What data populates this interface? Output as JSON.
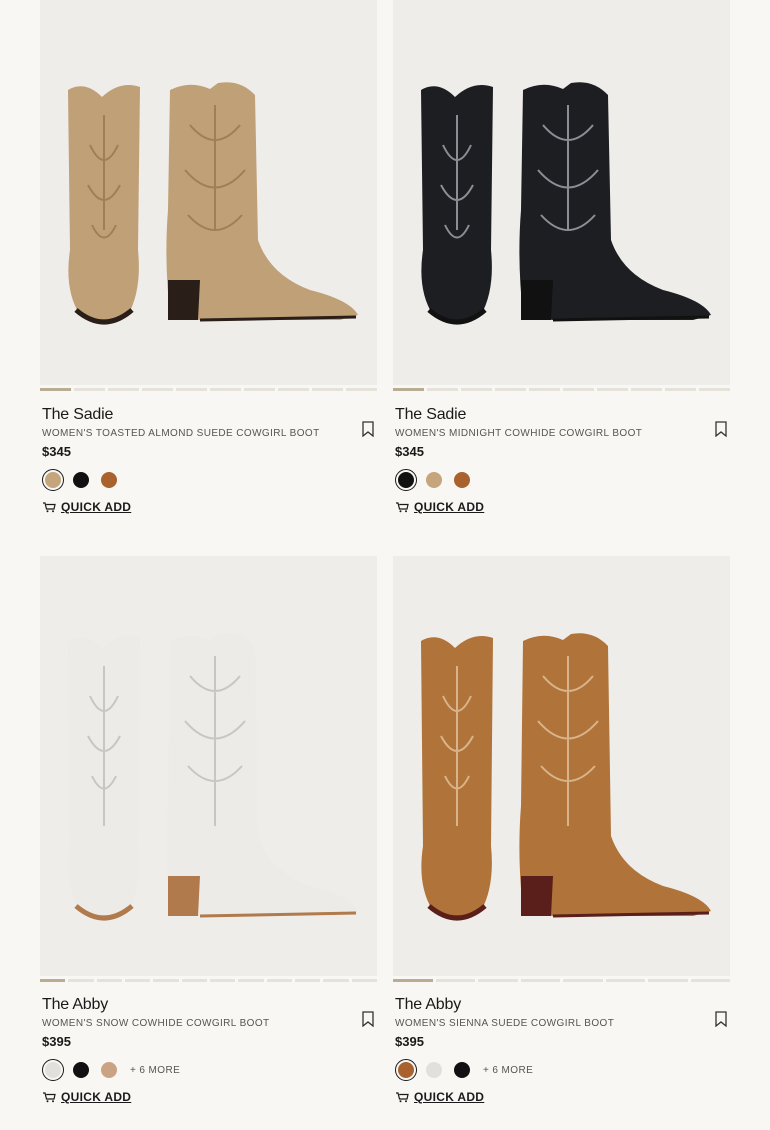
{
  "products": [
    {
      "name": "The Sadie",
      "subtitle": "WOMEN'S TOASTED ALMOND SUEDE COWGIRL BOOT",
      "price": "$345",
      "image_slides": 10,
      "active_slide": 1,
      "boot_color": "#c0a077",
      "stitch_color": "#a07e58",
      "heel_color": "#2a1e18",
      "swatches": [
        "#c5a57c",
        "#111111",
        "#a9612d"
      ],
      "selected_swatch": 0,
      "more_colors": "",
      "quick_add_label": "QUICK ADD"
    },
    {
      "name": "The Sadie",
      "subtitle": "WOMEN'S MIDNIGHT COWHIDE COWGIRL BOOT",
      "price": "$345",
      "image_slides": 10,
      "active_slide": 1,
      "boot_color": "#1c1e22",
      "stitch_color": "#8a8f96",
      "heel_color": "#111111",
      "swatches": [
        "#111111",
        "#c5a57c",
        "#a9612d"
      ],
      "selected_swatch": 0,
      "more_colors": "",
      "quick_add_label": "QUICK ADD"
    },
    {
      "name": "The Abby",
      "subtitle": "WOMEN'S SNOW COWHIDE COWGIRL BOOT",
      "price": "$395",
      "image_slides": 12,
      "active_slide": 1,
      "boot_color": "#ecebe8",
      "stitch_color": "#c8c6c2",
      "heel_color": "#b07a4c",
      "swatches": [
        "#e2e0dc",
        "#111111",
        "#c9a383"
      ],
      "selected_swatch": 0,
      "more_colors": "+ 6 MORE",
      "quick_add_label": "QUICK ADD"
    },
    {
      "name": "The Abby",
      "subtitle": "WOMEN'S SIENNA SUEDE COWGIRL BOOT",
      "price": "$395",
      "image_slides": 8,
      "active_slide": 1,
      "boot_color": "#b0733a",
      "stitch_color": "#d9b48a",
      "heel_color": "#5a1f1a",
      "swatches": [
        "#a9612d",
        "#e2e0dc",
        "#111111"
      ],
      "selected_swatch": 0,
      "more_colors": "+ 6 MORE",
      "quick_add_label": "QUICK ADD"
    }
  ],
  "icons": {
    "bookmark": "bookmark-icon",
    "quick_add": "cart-icon"
  }
}
